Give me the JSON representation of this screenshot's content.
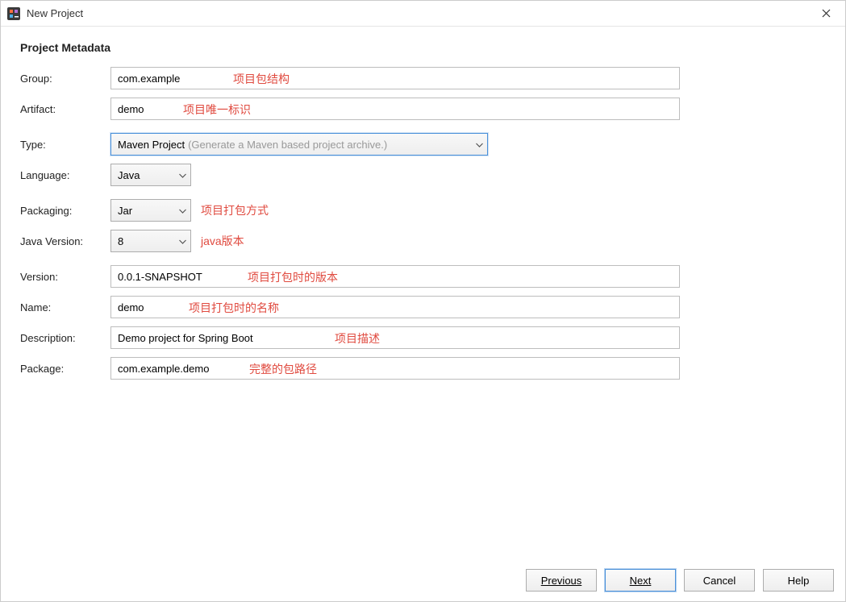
{
  "window": {
    "title": "New Project"
  },
  "section": {
    "header": "Project Metadata"
  },
  "labels": {
    "group": "Group:",
    "artifact": "Artifact:",
    "type": "Type:",
    "language": "Language:",
    "packaging": "Packaging:",
    "java_version": "Java Version:",
    "version": "Version:",
    "name": "Name:",
    "description": "Description:",
    "package": "Package:"
  },
  "fields": {
    "group": "com.example",
    "artifact": "demo",
    "type_selected": "Maven Project",
    "type_desc": "(Generate a Maven based project archive.)",
    "language_selected": "Java",
    "packaging_selected": "Jar",
    "java_version_selected": "8",
    "version": "0.0.1-SNAPSHOT",
    "name": "demo",
    "description": "Demo project for Spring Boot",
    "package": "com.example.demo"
  },
  "annotations": {
    "group": "项目包结构",
    "artifact": "项目唯一标识",
    "packaging": "项目打包方式",
    "java_version": "java版本",
    "version": "项目打包时的版本",
    "name": "项目打包时的名称",
    "description": "项目描述",
    "package": "完整的包路径"
  },
  "buttons": {
    "previous": "Previous",
    "next": "Next",
    "cancel": "Cancel",
    "help": "Help"
  }
}
